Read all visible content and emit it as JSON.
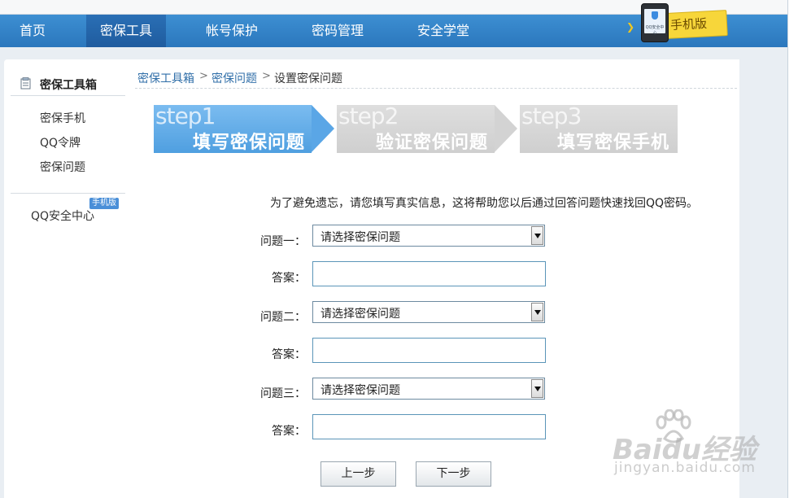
{
  "nav": {
    "items": [
      {
        "label": "首页",
        "active": false
      },
      {
        "label": "密保工具",
        "active": true
      },
      {
        "label": "帐号保护",
        "active": false
      },
      {
        "label": "密码管理",
        "active": false
      },
      {
        "label": "安全学堂",
        "active": false
      }
    ],
    "promo_label": "手机版",
    "promo_phone_caption": "QQ安全中心"
  },
  "sidebar": {
    "title": "密保工具箱",
    "items": [
      "密保手机",
      "QQ令牌",
      "密保问题"
    ],
    "security_center": "QQ安全中心",
    "badge": "手机版"
  },
  "breadcrumb": {
    "items": [
      "密保工具箱",
      "密保问题",
      "设置密保问题"
    ],
    "separator": ">"
  },
  "steps": [
    {
      "num": "step1",
      "title": "填写密保问题",
      "active": true
    },
    {
      "num": "step2",
      "title": "验证密保问题",
      "active": false
    },
    {
      "num": "step3",
      "title": "填写密保手机",
      "active": false
    }
  ],
  "form": {
    "intro": "为了避免遗忘，请您填写真实信息，这将帮助您以后通过回答问题快速找回QQ密码。",
    "questions": [
      {
        "label": "问题一：",
        "selected": "请选择密保问题",
        "answer_label": "答案：",
        "answer_value": ""
      },
      {
        "label": "问题二：",
        "selected": "请选择密保问题",
        "answer_label": "答案：",
        "answer_value": ""
      },
      {
        "label": "问题三：",
        "selected": "请选择密保问题",
        "answer_label": "答案：",
        "answer_value": ""
      }
    ],
    "prev_button": "上一步",
    "next_button": "下一步"
  },
  "watermark": {
    "logo": "Baidu经验",
    "url": "jingyan.baidu.com"
  },
  "colors": {
    "nav_bar": "#3d8fd2",
    "step_active": "#5aa6e6",
    "step_inactive": "#d3d3d3",
    "link": "#2f6ea8",
    "badge": "#4a8fd8"
  }
}
